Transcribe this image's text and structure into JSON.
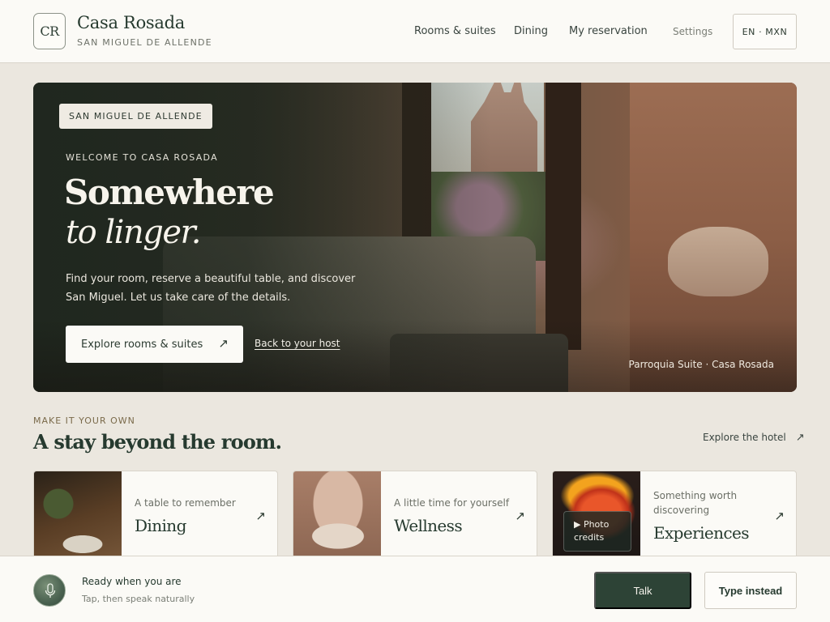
{
  "header": {
    "logo_mark": "CR",
    "brand_name": "Casa Rosada",
    "brand_sub": "SAN MIGUEL DE ALLENDE",
    "nav": {
      "rooms": "Rooms & suites",
      "dining": "Dining",
      "reservation": "My reservation",
      "settings": "Settings"
    },
    "lang_currency": "EN · MXN"
  },
  "hero": {
    "tag": "SAN MIGUEL DE ALLENDE",
    "welcome": "WELCOME TO CASA ROSADA",
    "title_line1": "Somewhere",
    "title_line2": "to linger.",
    "description": "Find your room, reserve a beautiful table, and discover San Miguel. Let us take care of the details.",
    "primary_cta": "Explore rooms & suites",
    "secondary_cta": "Back to your host",
    "caption": "Parroquia Suite · Casa Rosada"
  },
  "section": {
    "kicker": "MAKE IT YOUR OWN",
    "title": "A stay beyond the room.",
    "explore_link": "Explore the hotel"
  },
  "cards": [
    {
      "kicker": "A table to remember",
      "title": "Dining"
    },
    {
      "kicker": "A little time for yourself",
      "title": "Wellness"
    },
    {
      "kicker_line1": "Something worth",
      "kicker_line2": "discovering",
      "title": "Experiences",
      "photo_credits_line1": "▶ Photo",
      "photo_credits_line2": "credits"
    }
  ],
  "voice": {
    "title": "Ready when you are",
    "subtitle": "Tap, then speak naturally",
    "talk_label": "Talk",
    "type_label": "Type instead"
  },
  "icons": {
    "arrow": "↗"
  },
  "colors": {
    "accent_dark_green": "#2d4336",
    "background": "#ebe7df",
    "surface": "#fbfaf6"
  }
}
